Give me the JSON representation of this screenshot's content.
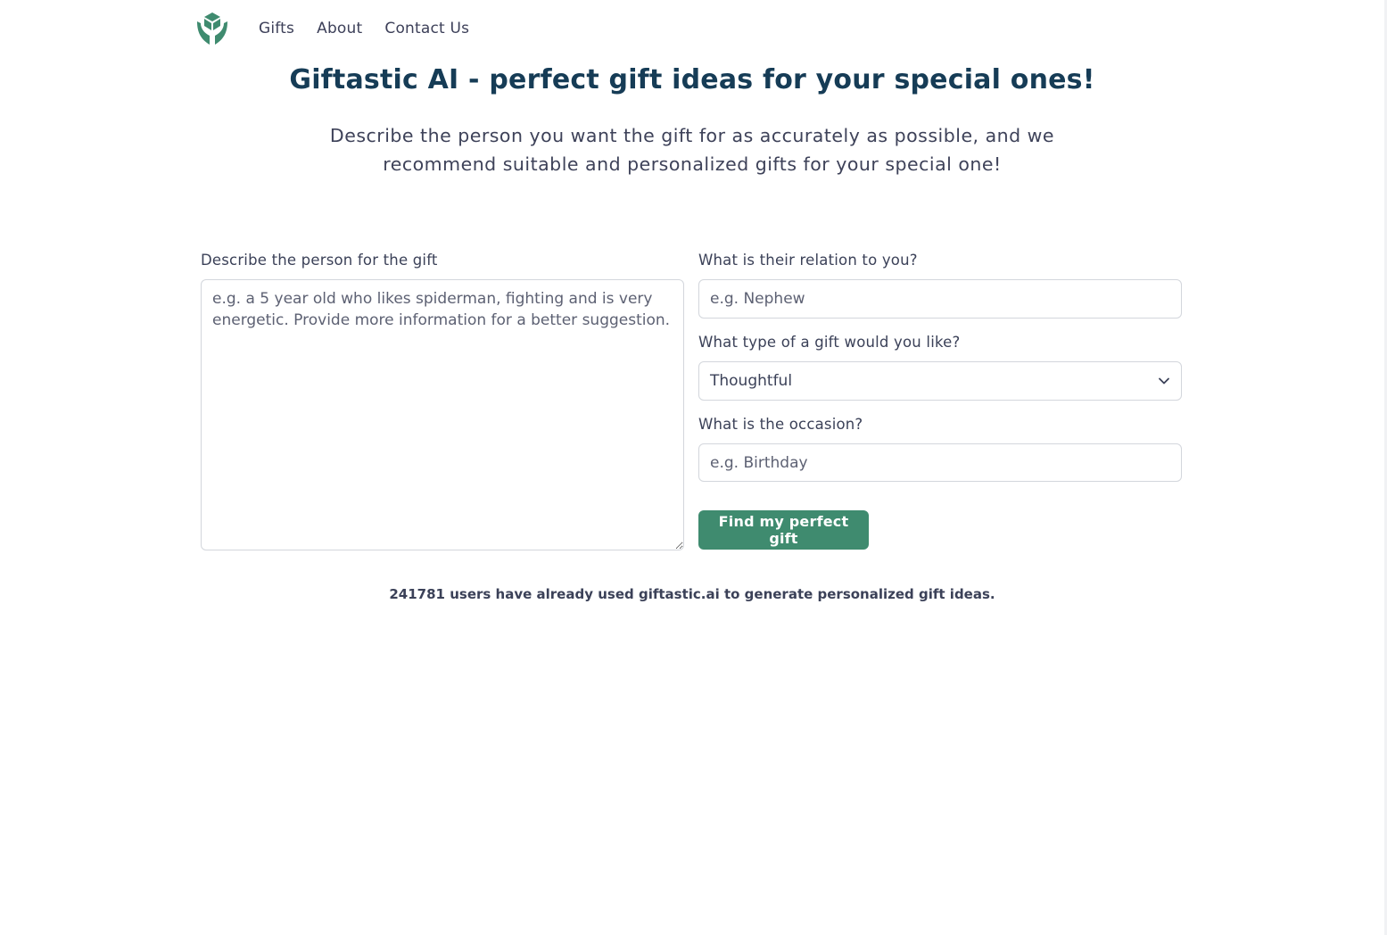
{
  "nav": {
    "logo_icon": "leaf-hands-icon",
    "links": [
      "Gifts",
      "About",
      "Contact Us"
    ]
  },
  "hero": {
    "title": "Giftastic AI - perfect gift ideas for your special ones!",
    "subtitle": "Describe the person you want the gift for as accurately as possible, and we recommend suitable and personalized gifts for your special one!"
  },
  "form": {
    "description": {
      "label": "Describe the person for the gift",
      "placeholder": "e.g. a 5 year old who likes spiderman, fighting and is very energetic. Provide more information for a better suggestion.",
      "value": ""
    },
    "relation": {
      "label": "What is their relation to you?",
      "placeholder": "e.g. Nephew",
      "value": ""
    },
    "gift_type": {
      "label": "What type of a gift would you like?",
      "selected": "Thoughtful",
      "icon": "chevron-down-icon"
    },
    "occasion": {
      "label": "What is the occasion?",
      "placeholder": "e.g. Birthday",
      "value": ""
    },
    "submit_label": "Find my perfect gift"
  },
  "stats": {
    "text": "241781 users have already used giftastic.ai to generate personalized gift ideas."
  },
  "colors": {
    "brand_green": "#3f8b6f",
    "title_navy": "#163c56",
    "text": "#3b4158",
    "border": "#d3d6dc"
  }
}
